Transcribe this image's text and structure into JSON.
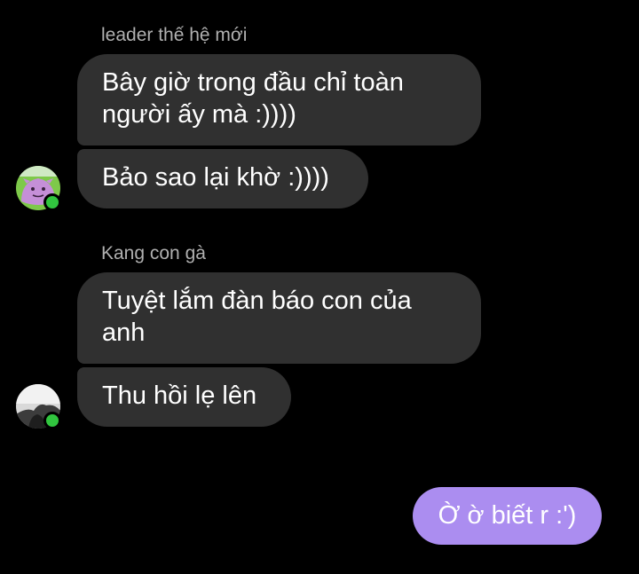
{
  "theme": {
    "background": "#000000",
    "incoming_bubble": "#303030",
    "outgoing_bubble": "#ab8df0",
    "sender_name_color": "#b0b0b0",
    "online_color": "#31c53f"
  },
  "groups": [
    {
      "sender": "leader thế hệ mới",
      "avatar_icon": "pink-creature-avatar-icon",
      "online": true,
      "messages": [
        {
          "line1": "Bây giờ trong đầu chỉ toàn",
          "line2": "người ấy mà :))))"
        },
        {
          "text": "Bảo sao lại khờ :))))"
        }
      ]
    },
    {
      "sender": "Kang con gà",
      "avatar_icon": "grayscale-photo-avatar-icon",
      "online": true,
      "messages": [
        {
          "line1": "Tuyệt lắm đàn báo con của",
          "line2": "anh"
        },
        {
          "text": "Thu hồi lẹ lên"
        }
      ]
    }
  ],
  "outgoing": {
    "text": "Ờ ờ biết r :')"
  }
}
